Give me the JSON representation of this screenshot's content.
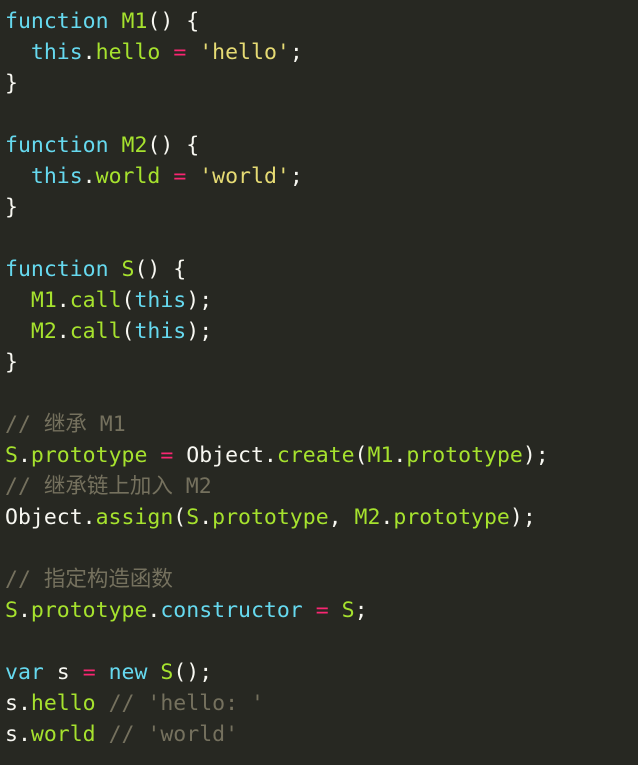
{
  "colors": {
    "background": "#272822",
    "keyword": "#66d9ef",
    "function_name": "#a6e22e",
    "plain": "#f8f8f2",
    "operator": "#f92672",
    "string": "#e6db74",
    "comment": "#75715e"
  },
  "code": {
    "lines": [
      [
        {
          "t": "function",
          "k": "keyword"
        },
        {
          "t": " ",
          "k": "plain"
        },
        {
          "t": "M1",
          "k": "fn"
        },
        {
          "t": "() {",
          "k": "plain"
        }
      ],
      [
        {
          "t": "  ",
          "k": "plain"
        },
        {
          "t": "this",
          "k": "this"
        },
        {
          "t": ".",
          "k": "plain"
        },
        {
          "t": "hello",
          "k": "prop"
        },
        {
          "t": " ",
          "k": "plain"
        },
        {
          "t": "=",
          "k": "op"
        },
        {
          "t": " ",
          "k": "plain"
        },
        {
          "t": "'hello'",
          "k": "string"
        },
        {
          "t": ";",
          "k": "plain"
        }
      ],
      [
        {
          "t": "}",
          "k": "plain"
        }
      ],
      [],
      [
        {
          "t": "function",
          "k": "keyword"
        },
        {
          "t": " ",
          "k": "plain"
        },
        {
          "t": "M2",
          "k": "fn"
        },
        {
          "t": "() {",
          "k": "plain"
        }
      ],
      [
        {
          "t": "  ",
          "k": "plain"
        },
        {
          "t": "this",
          "k": "this"
        },
        {
          "t": ".",
          "k": "plain"
        },
        {
          "t": "world",
          "k": "prop"
        },
        {
          "t": " ",
          "k": "plain"
        },
        {
          "t": "=",
          "k": "op"
        },
        {
          "t": " ",
          "k": "plain"
        },
        {
          "t": "'world'",
          "k": "string"
        },
        {
          "t": ";",
          "k": "plain"
        }
      ],
      [
        {
          "t": "}",
          "k": "plain"
        }
      ],
      [],
      [
        {
          "t": "function",
          "k": "keyword"
        },
        {
          "t": " ",
          "k": "plain"
        },
        {
          "t": "S",
          "k": "fn"
        },
        {
          "t": "() {",
          "k": "plain"
        }
      ],
      [
        {
          "t": "  ",
          "k": "plain"
        },
        {
          "t": "M1",
          "k": "fn"
        },
        {
          "t": ".",
          "k": "plain"
        },
        {
          "t": "call",
          "k": "prop"
        },
        {
          "t": "(",
          "k": "plain"
        },
        {
          "t": "this",
          "k": "this"
        },
        {
          "t": ");",
          "k": "plain"
        }
      ],
      [
        {
          "t": "  ",
          "k": "plain"
        },
        {
          "t": "M2",
          "k": "fn"
        },
        {
          "t": ".",
          "k": "plain"
        },
        {
          "t": "call",
          "k": "prop"
        },
        {
          "t": "(",
          "k": "plain"
        },
        {
          "t": "this",
          "k": "this"
        },
        {
          "t": ");",
          "k": "plain"
        }
      ],
      [
        {
          "t": "}",
          "k": "plain"
        }
      ],
      [],
      [
        {
          "t": "// 继承 M1",
          "k": "comment"
        }
      ],
      [
        {
          "t": "S",
          "k": "fn"
        },
        {
          "t": ".",
          "k": "plain"
        },
        {
          "t": "prototype",
          "k": "prop"
        },
        {
          "t": " ",
          "k": "plain"
        },
        {
          "t": "=",
          "k": "op"
        },
        {
          "t": " Object.",
          "k": "plain"
        },
        {
          "t": "create",
          "k": "prop"
        },
        {
          "t": "(",
          "k": "plain"
        },
        {
          "t": "M1",
          "k": "fn"
        },
        {
          "t": ".",
          "k": "plain"
        },
        {
          "t": "prototype",
          "k": "prop"
        },
        {
          "t": ");",
          "k": "plain"
        }
      ],
      [
        {
          "t": "// 继承链上加入 M2",
          "k": "comment"
        }
      ],
      [
        {
          "t": "Object.",
          "k": "plain"
        },
        {
          "t": "assign",
          "k": "prop"
        },
        {
          "t": "(",
          "k": "plain"
        },
        {
          "t": "S",
          "k": "fn"
        },
        {
          "t": ".",
          "k": "plain"
        },
        {
          "t": "prototype",
          "k": "prop"
        },
        {
          "t": ", ",
          "k": "plain"
        },
        {
          "t": "M2",
          "k": "fn"
        },
        {
          "t": ".",
          "k": "plain"
        },
        {
          "t": "prototype",
          "k": "prop"
        },
        {
          "t": ");",
          "k": "plain"
        }
      ],
      [],
      [
        {
          "t": "// 指定构造函数",
          "k": "comment"
        }
      ],
      [
        {
          "t": "S",
          "k": "fn"
        },
        {
          "t": ".",
          "k": "plain"
        },
        {
          "t": "prototype",
          "k": "prop"
        },
        {
          "t": ".",
          "k": "plain"
        },
        {
          "t": "constructor",
          "k": "this"
        },
        {
          "t": " ",
          "k": "plain"
        },
        {
          "t": "=",
          "k": "op"
        },
        {
          "t": " ",
          "k": "plain"
        },
        {
          "t": "S",
          "k": "fn"
        },
        {
          "t": ";",
          "k": "plain"
        }
      ],
      [],
      [
        {
          "t": "var",
          "k": "keyword"
        },
        {
          "t": " s ",
          "k": "plain"
        },
        {
          "t": "=",
          "k": "op"
        },
        {
          "t": " ",
          "k": "plain"
        },
        {
          "t": "new",
          "k": "keyword"
        },
        {
          "t": " ",
          "k": "plain"
        },
        {
          "t": "S",
          "k": "fn"
        },
        {
          "t": "();",
          "k": "plain"
        }
      ],
      [
        {
          "t": "s",
          "k": "plain"
        },
        {
          "t": ".",
          "k": "plain"
        },
        {
          "t": "hello",
          "k": "prop"
        },
        {
          "t": " // 'hello: '",
          "k": "comment"
        }
      ],
      [
        {
          "t": "s",
          "k": "plain"
        },
        {
          "t": ".",
          "k": "plain"
        },
        {
          "t": "world",
          "k": "prop"
        },
        {
          "t": " // 'world'",
          "k": "comment"
        }
      ]
    ]
  }
}
